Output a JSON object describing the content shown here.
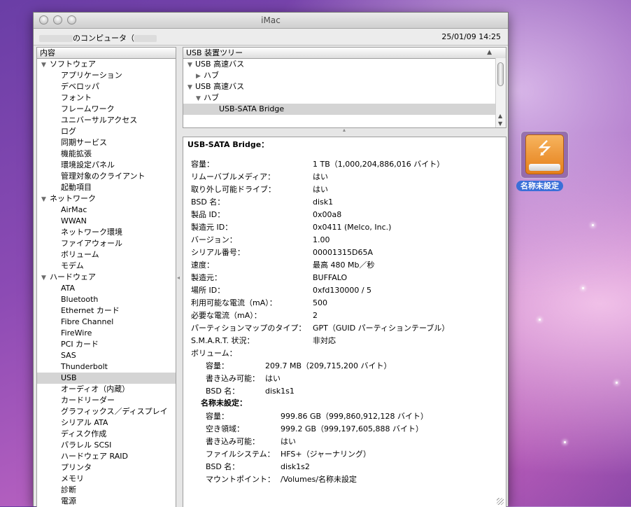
{
  "window": {
    "title": "iMac"
  },
  "infobar": {
    "computer_name_suffix": "のコンピュータ",
    "datetime": "25/01/09 14:25"
  },
  "sidebar": {
    "header": "内容",
    "items": [
      {
        "label": "ソフトウェア",
        "level": 0,
        "expanded": true
      },
      {
        "label": "アプリケーション",
        "level": 1
      },
      {
        "label": "デベロッパ",
        "level": 1
      },
      {
        "label": "フォント",
        "level": 1
      },
      {
        "label": "フレームワーク",
        "level": 1
      },
      {
        "label": "ユニバーサルアクセス",
        "level": 1
      },
      {
        "label": "ログ",
        "level": 1
      },
      {
        "label": "同期サービス",
        "level": 1
      },
      {
        "label": "機能拡張",
        "level": 1
      },
      {
        "label": "環境設定パネル",
        "level": 1
      },
      {
        "label": "管理対象のクライアント",
        "level": 1
      },
      {
        "label": "起動項目",
        "level": 1
      },
      {
        "label": "ネットワーク",
        "level": 0,
        "expanded": true
      },
      {
        "label": "AirMac",
        "level": 1
      },
      {
        "label": "WWAN",
        "level": 1
      },
      {
        "label": "ネットワーク環境",
        "level": 1
      },
      {
        "label": "ファイアウォール",
        "level": 1
      },
      {
        "label": "ボリューム",
        "level": 1
      },
      {
        "label": "モデム",
        "level": 1
      },
      {
        "label": "ハードウェア",
        "level": 0,
        "expanded": true
      },
      {
        "label": "ATA",
        "level": 1
      },
      {
        "label": "Bluetooth",
        "level": 1
      },
      {
        "label": "Ethernet カード",
        "level": 1
      },
      {
        "label": "Fibre Channel",
        "level": 1
      },
      {
        "label": "FireWire",
        "level": 1
      },
      {
        "label": "PCI カード",
        "level": 1
      },
      {
        "label": "SAS",
        "level": 1
      },
      {
        "label": "Thunderbolt",
        "level": 1
      },
      {
        "label": "USB",
        "level": 1,
        "selected": true
      },
      {
        "label": "オーディオ（内蔵）",
        "level": 1
      },
      {
        "label": "カードリーダー",
        "level": 1
      },
      {
        "label": "グラフィックス／ディスプレイ",
        "level": 1
      },
      {
        "label": "シリアル ATA",
        "level": 1
      },
      {
        "label": "ディスク作成",
        "level": 1
      },
      {
        "label": "パラレル SCSI",
        "level": 1
      },
      {
        "label": "ハードウェア RAID",
        "level": 1
      },
      {
        "label": "プリンタ",
        "level": 1
      },
      {
        "label": "メモリ",
        "level": 1
      },
      {
        "label": "診断",
        "level": 1
      },
      {
        "label": "電源",
        "level": 1
      }
    ]
  },
  "tree": {
    "header": "USB 装置ツリー",
    "items": [
      {
        "label": "USB 高速バス",
        "level": 0,
        "state": "open"
      },
      {
        "label": "ハブ",
        "level": 1,
        "state": "closed"
      },
      {
        "label": "USB 高速バス",
        "level": 0,
        "state": "open"
      },
      {
        "label": "ハブ",
        "level": 1,
        "state": "open"
      },
      {
        "label": "USB-SATA Bridge",
        "level": 3,
        "selected": true
      }
    ]
  },
  "detail": {
    "title": "USB-SATA Bridge：",
    "props": [
      {
        "k": "容量：",
        "v": "1 TB（1,000,204,886,016 バイト）"
      },
      {
        "k": "リムーバブルメディア：",
        "v": "はい"
      },
      {
        "k": "取り外し可能ドライブ：",
        "v": "はい"
      },
      {
        "k": "BSD 名：",
        "v": "disk1"
      },
      {
        "k": "製品 ID：",
        "v": "0x00a8"
      },
      {
        "k": "製造元 ID：",
        "v": "0x0411  (Melco, Inc.)"
      },
      {
        "k": "バージョン：",
        "v": " 1.00"
      },
      {
        "k": "シリアル番号：",
        "v": "00001315D65A"
      },
      {
        "k": "速度：",
        "v": "最高 480 Mb／秒"
      },
      {
        "k": "製造元：",
        "v": "BUFFALO"
      },
      {
        "k": "場所 ID：",
        "v": "0xfd130000 / 5"
      },
      {
        "k": "利用可能な電流（mA）：",
        "v": "500"
      },
      {
        "k": "必要な電流（mA）：",
        "v": "2"
      },
      {
        "k": "パーティションマップのタイプ：",
        "v": "GPT（GUID パーティションテーブル）"
      },
      {
        "k": "S.M.A.R.T. 状況：",
        "v": "非対応"
      }
    ],
    "volumes_label": "ボリューム：",
    "vol1": [
      {
        "k": "容量：",
        "v": "209.7 MB（209,715,200 バイト）"
      },
      {
        "k": "書き込み可能：",
        "v": "はい"
      },
      {
        "k": "BSD 名：",
        "v": "disk1s1"
      }
    ],
    "vol2_title": "名称未設定：",
    "vol2": [
      {
        "k": "容量：",
        "v": "999.86 GB（999,860,912,128 バイト）"
      },
      {
        "k": "空き領域：",
        "v": "999.2 GB（999,197,605,888 バイト）"
      },
      {
        "k": "書き込み可能：",
        "v": "はい"
      },
      {
        "k": "ファイルシステム：",
        "v": "HFS+（ジャーナリング）"
      },
      {
        "k": "BSD 名：",
        "v": "disk1s2"
      },
      {
        "k": "マウントポイント：",
        "v": "/Volumes/名称未設定"
      }
    ]
  },
  "desktop": {
    "disk_label": "名称未設定",
    "disk_icon": "usb-disk-icon"
  }
}
